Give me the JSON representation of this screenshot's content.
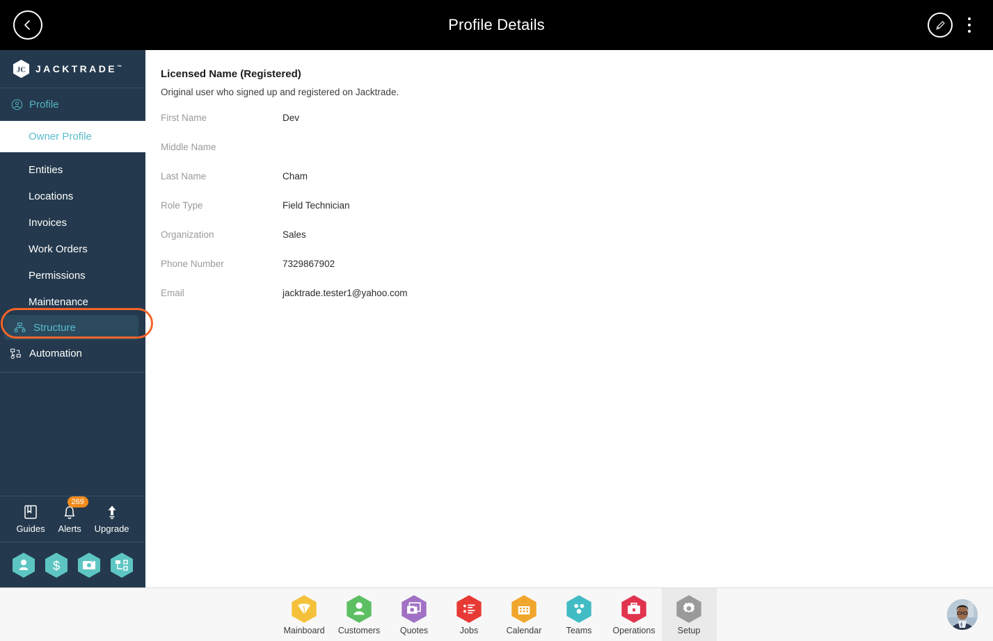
{
  "topbar": {
    "title": "Profile Details",
    "back_icon": "chevron-left-icon",
    "edit_icon": "pencil-icon",
    "menu_icon": "kebab-menu-icon"
  },
  "sidebar": {
    "brand": {
      "name": "JACKTRADE",
      "tm": "™"
    },
    "group": {
      "label": "Profile",
      "icon": "user-circle-icon"
    },
    "sub_item": {
      "label": "Owner Profile"
    },
    "items": [
      {
        "label": "Entities",
        "icon": "",
        "highlighted": false
      },
      {
        "label": "Locations",
        "icon": "",
        "highlighted": false
      },
      {
        "label": "Invoices",
        "icon": "",
        "highlighted": false
      },
      {
        "label": "Work Orders",
        "icon": "",
        "highlighted": false
      },
      {
        "label": "Permissions",
        "icon": "",
        "highlighted": false
      },
      {
        "label": "Maintenance",
        "icon": "",
        "highlighted": false
      },
      {
        "label": "Structure",
        "icon": "structure-tree-icon",
        "highlighted": true
      },
      {
        "label": "Automation",
        "icon": "automation-flow-icon",
        "highlighted": false
      }
    ],
    "utilities": [
      {
        "label": "Guides",
        "icon": "book-icon",
        "badge": ""
      },
      {
        "label": "Alerts",
        "icon": "bell-icon",
        "badge": "269"
      },
      {
        "label": "Upgrade",
        "icon": "up-arrow-icon",
        "badge": ""
      }
    ],
    "quick_hexes": [
      {
        "name": "person-hex-icon"
      },
      {
        "name": "dollar-hex-icon"
      },
      {
        "name": "money-transfer-hex-icon"
      },
      {
        "name": "workflow-hex-icon"
      }
    ],
    "accent_color": "#5bbccd",
    "background_color": "#24394D",
    "highlight_ring_color": "#f4642a",
    "badge_color": "#F08A1C"
  },
  "main": {
    "section_title": "Licensed Name (Registered)",
    "section_subtitle": "Original user who signed up and registered on Jacktrade.",
    "fields": [
      {
        "label": "First Name",
        "value": "Dev"
      },
      {
        "label": "Middle Name",
        "value": ""
      },
      {
        "label": "Last Name",
        "value": "Cham"
      },
      {
        "label": "Role Type",
        "value": "Field Technician"
      },
      {
        "label": "Organization",
        "value": "Sales"
      },
      {
        "label": "Phone Number",
        "value": "7329867902"
      },
      {
        "label": "Email",
        "value": "jacktrade.tester1@yahoo.com"
      }
    ]
  },
  "bottombar": {
    "items": [
      {
        "label": "Mainboard",
        "icon": "mainboard-hex-icon",
        "color": "#F5C13A",
        "active": false
      },
      {
        "label": "Customers",
        "icon": "customers-hex-icon",
        "color": "#5DBF63",
        "active": false
      },
      {
        "label": "Quotes",
        "icon": "quotes-hex-icon",
        "color": "#A071C4",
        "active": false
      },
      {
        "label": "Jobs",
        "icon": "jobs-hex-icon",
        "color": "#E83A35",
        "active": false
      },
      {
        "label": "Calendar",
        "icon": "calendar-hex-icon",
        "color": "#F0A62B",
        "active": false
      },
      {
        "label": "Teams",
        "icon": "teams-hex-icon",
        "color": "#42BCC4",
        "active": false
      },
      {
        "label": "Operations",
        "icon": "operations-hex-icon",
        "color": "#E0344F",
        "active": false
      },
      {
        "label": "Setup",
        "icon": "setup-gear-hex-icon",
        "color": "#9A9A9A",
        "active": true
      }
    ],
    "avatar": {
      "name": "user-avatar"
    }
  }
}
